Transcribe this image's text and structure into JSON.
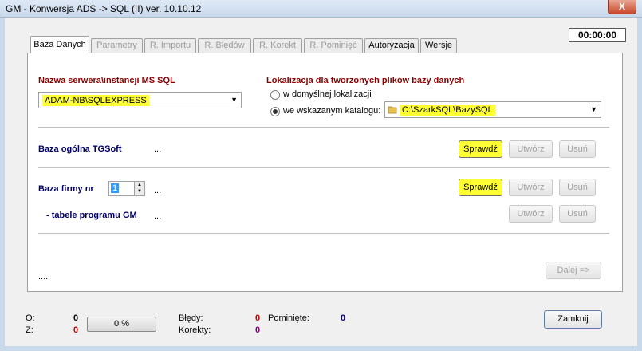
{
  "window": {
    "title": "GM - Konwersja ADS  ->  SQL  (II)      ver. 10.10.12",
    "close_label": "X"
  },
  "timer": "00:00:00",
  "tabs": [
    {
      "label": "Baza Danych",
      "state": "active"
    },
    {
      "label": "Parametry",
      "state": "disabled"
    },
    {
      "label": "R. Importu",
      "state": "disabled"
    },
    {
      "label": "R. Błędów",
      "state": "disabled"
    },
    {
      "label": "R. Korekt",
      "state": "disabled"
    },
    {
      "label": "R. Pominięć",
      "state": "disabled"
    },
    {
      "label": "Autoryzacja",
      "state": "enabled"
    },
    {
      "label": "Wersje",
      "state": "enabled"
    }
  ],
  "server": {
    "label": "Nazwa serwera\\instancji  MS SQL",
    "value": "ADAM-NB\\SQLEXPRESS"
  },
  "location": {
    "label": "Lokalizacja dla tworzonych plików bazy danych",
    "option_default": "w domyślnej lokalizacji",
    "option_custom": "we wskazanym katalogu:",
    "selected": "custom",
    "path": "C:\\SzarkSQL\\BazySQL"
  },
  "general_db": {
    "label": "Baza ogólna TGSoft",
    "dots": "...",
    "check": "Sprawdź",
    "create": "Utwórz",
    "delete": "Usuń"
  },
  "company_db": {
    "label": "Baza firmy nr",
    "number": "1",
    "dots": "...",
    "check": "Sprawdź",
    "create": "Utwórz",
    "delete": "Usuń"
  },
  "gm_tables": {
    "label": "- tabele programu GM",
    "dots": "...",
    "create": "Utwórz",
    "delete": "Usuń"
  },
  "bottom_dots": "....",
  "next_button": "Dalej =>",
  "status": {
    "o_label": "O:",
    "o_value": "0",
    "z_label": "Z:",
    "z_value": "0",
    "progress_text": "0 %",
    "progress": 0,
    "errors_label": "Błędy:",
    "errors_value": "0",
    "skipped_label": "Pominięte:",
    "skipped_value": "0",
    "corrections_label": "Korekty:",
    "corrections_value": "0"
  },
  "close_button": "Zamknij",
  "colors": {
    "highlight": "#ffff33",
    "red_label": "#8b0000",
    "navy_label": "#000066",
    "red_value": "#c00000",
    "navy_value": "#000080",
    "purple_value": "#800080"
  }
}
